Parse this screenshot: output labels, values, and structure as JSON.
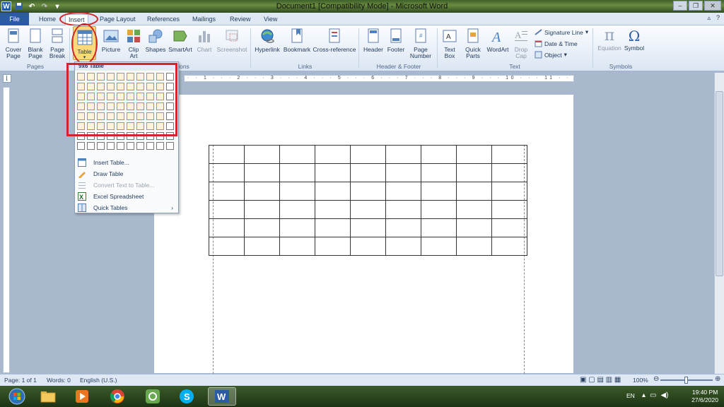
{
  "window": {
    "title": "Document1 [Compatibility Mode] - Microsoft Word"
  },
  "tabs": [
    {
      "label": "File"
    },
    {
      "label": "Home"
    },
    {
      "label": "Insert"
    },
    {
      "label": "Page Layout"
    },
    {
      "label": "References"
    },
    {
      "label": "Mailings"
    },
    {
      "label": "Review"
    },
    {
      "label": "View"
    }
  ],
  "ribbon": {
    "pages": {
      "cover": "Cover\nPage",
      "blank": "Blank\nPage",
      "break": "Page\nBreak",
      "label": "Pages"
    },
    "tables": {
      "table": "Table"
    },
    "illustrations": {
      "picture": "Picture",
      "clipart": "Clip\nArt",
      "shapes": "Shapes",
      "smartart": "SmartArt",
      "chart": "Chart",
      "screenshot": "Screenshot",
      "label_partial": "ions"
    },
    "links": {
      "hyperlink": "Hyperlink",
      "bookmark": "Bookmark",
      "crossref": "Cross-reference",
      "label": "Links"
    },
    "headerfooter": {
      "header": "Header",
      "footer": "Footer",
      "pagenumber": "Page\nNumber",
      "label": "Header & Footer"
    },
    "text": {
      "textbox": "Text\nBox",
      "quickparts": "Quick\nParts",
      "wordart": "WordArt",
      "dropcap": "Drop\nCap",
      "signature": "Signature Line",
      "datetime": "Date & Time",
      "object": "Object",
      "label": "Text"
    },
    "symbols": {
      "equation": "Equation",
      "symbol": "Symbol",
      "label": "Symbols"
    }
  },
  "ruler": {
    "marks": "· · 1 · · · 2 · · · 3 · · · 4 · · · 5 · · · 6 · · · 7 · · · 8 · · · 9 · · · 10 · · · 11 · · · 12 · · · 13 · · · 14 · · · 15 · · · 16 · · · 17 · ·"
  },
  "dropdown": {
    "header": "9x6 Table",
    "grid": {
      "cols": 10,
      "rows": 8,
      "hl_cols": 9,
      "hl_rows": 6
    },
    "items": [
      {
        "label": "Insert Table...",
        "icon": "insert-table-icon",
        "disabled": false
      },
      {
        "label": "Draw Table",
        "icon": "draw-table-icon",
        "disabled": false
      },
      {
        "label": "Convert Text to Table...",
        "icon": "convert-text-icon",
        "disabled": true
      },
      {
        "label": "Excel Spreadsheet",
        "icon": "excel-icon",
        "disabled": false
      },
      {
        "label": "Quick Tables",
        "icon": "quick-tables-icon",
        "disabled": false,
        "submenu": "›"
      }
    ]
  },
  "document": {
    "table": {
      "cols": 9,
      "rows": 6
    }
  },
  "statusbar": {
    "page": "Page: 1 of 1",
    "words": "Words: 0",
    "language": "English (U.S.)",
    "zoom": "100%"
  },
  "taskbar": {
    "lang": "EN",
    "time": "19:40 PM",
    "date": "27/6/2020"
  },
  "colors": {
    "accent": "#2a5ba3",
    "highlight": "#e48a12",
    "annotation": "#d12626"
  }
}
